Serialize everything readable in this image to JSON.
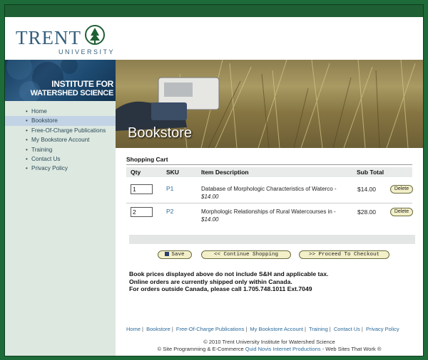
{
  "brand": {
    "name": "TRENT",
    "subname": "UNIVERSITY"
  },
  "institute": {
    "line1": "INSTITUTE FOR",
    "line2": "WATERSHED SCIENCE"
  },
  "nav": {
    "items": [
      {
        "label": "Home",
        "active": false
      },
      {
        "label": "Bookstore",
        "active": true
      },
      {
        "label": "Free-Of-Charge Publications",
        "active": false
      },
      {
        "label": "My Bookstore Account",
        "active": false
      },
      {
        "label": "Training",
        "active": false
      },
      {
        "label": "Contact Us",
        "active": false
      },
      {
        "label": "Privacy Policy",
        "active": false
      }
    ]
  },
  "hero": {
    "title": "Bookstore"
  },
  "cart": {
    "title": "Shopping Cart",
    "headers": {
      "qty": "Qty",
      "sku": "SKU",
      "desc": "Item Description",
      "subtotal": "Sub Total"
    },
    "rows": [
      {
        "qty": "1",
        "sku": "P1",
        "desc": "Database of Morphologic Characteristics of Waterco -",
        "price": "$14.00",
        "subtotal": "$14.00",
        "delete": "Delete"
      },
      {
        "qty": "2",
        "sku": "P2",
        "desc": "Morphologic Relationships of Rural Watercourses in -",
        "price": "$14.00",
        "subtotal": "$28.00",
        "delete": "Delete"
      }
    ]
  },
  "buttons": {
    "save": "Save",
    "continue": "<< Continue Shopping",
    "checkout": ">> Proceed To Checkout"
  },
  "notice": {
    "line1": "Book prices displayed above do not include S&H and applicable tax.",
    "line2": "Online orders are currently shipped only within Canada.",
    "line3": "For orders outside Canada, please call 1.705.748.1011 Ext.7049"
  },
  "footer": {
    "links": [
      "Home",
      "Bookstore",
      "Free-Of-Charge Publications",
      "My Bookstore Account",
      "Training",
      "Contact Us",
      "Privacy Policy"
    ],
    "copyright": "© 2010 Trent University Institute for Watershed Science",
    "credit_prefix": "© Site Programming & E-Commerce",
    "credit_link": "Quid Novis Internet Productions",
    "credit_suffix": "- Web Sites That Work ®"
  }
}
